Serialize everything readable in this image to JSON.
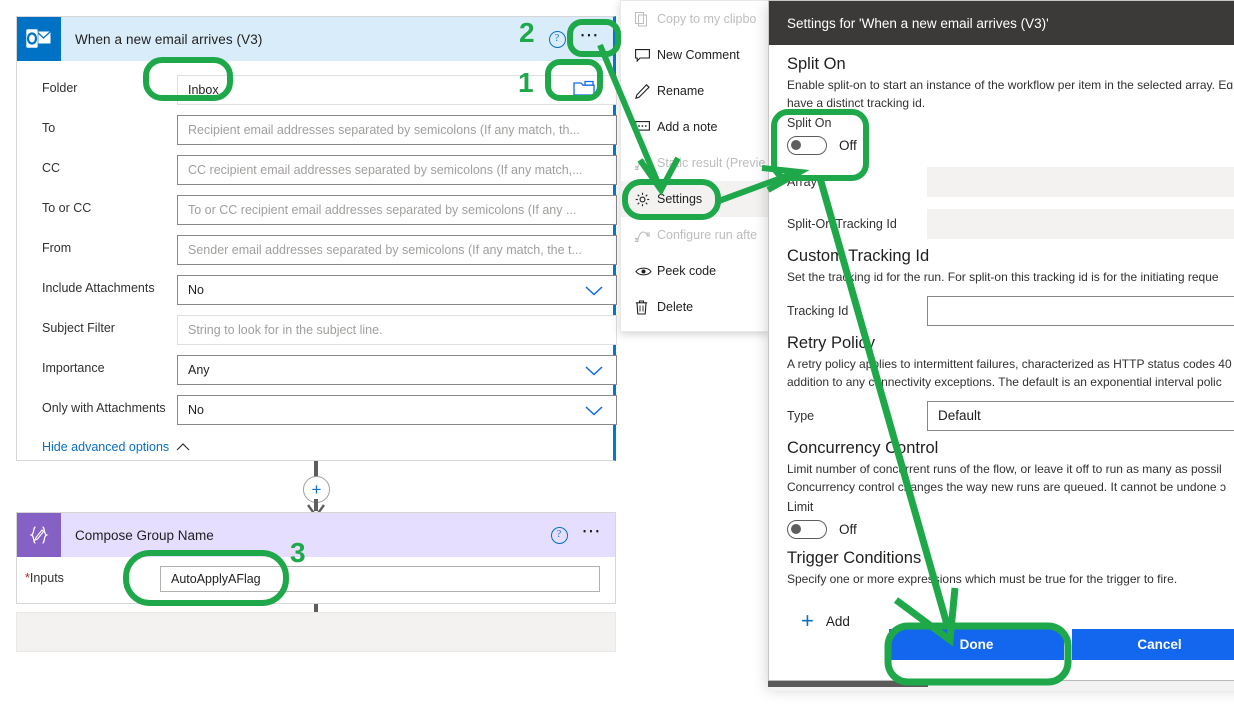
{
  "trigger_card": {
    "icon": "outlook-icon",
    "title": "When a new email arrives (V3)",
    "help_icon": "help-icon",
    "overflow_icon": "ellipsis-icon",
    "fields": [
      {
        "label": "Folder",
        "value": "Inbox",
        "placeholder": "",
        "type": "picker"
      },
      {
        "label": "To",
        "value": "",
        "placeholder": "Recipient email addresses separated by semicolons (If any match, th...",
        "type": "text"
      },
      {
        "label": "CC",
        "value": "",
        "placeholder": "CC recipient email addresses separated by semicolons (If any match,...",
        "type": "text"
      },
      {
        "label": "To or CC",
        "value": "",
        "placeholder": "To or CC recipient email addresses separated by semicolons (If any ...",
        "type": "text"
      },
      {
        "label": "From",
        "value": "",
        "placeholder": "Sender email addresses separated by semicolons (If any match, the t...",
        "type": "text"
      },
      {
        "label": "Include Attachments",
        "value": "No",
        "placeholder": "",
        "type": "select"
      },
      {
        "label": "Subject Filter",
        "value": "",
        "placeholder": "String to look for in the subject line.",
        "type": "text"
      },
      {
        "label": "Importance",
        "value": "Any",
        "placeholder": "",
        "type": "select"
      },
      {
        "label": "Only with Attachments",
        "value": "No",
        "placeholder": "",
        "type": "select"
      }
    ],
    "hide_advanced_label": "Hide advanced options"
  },
  "compose_card": {
    "icon": "compose-icon",
    "title": "Compose Group Name",
    "help_icon": "help-icon",
    "overflow_icon": "ellipsis-icon",
    "inputs_label": "Inputs",
    "required_marker": "*",
    "inputs_value": "AutoApplyAFlag"
  },
  "context_menu": {
    "items": [
      {
        "label": "Copy to my clipbo",
        "icon": "copy-icon",
        "disabled": true,
        "highlighted": false
      },
      {
        "label": "New Comment",
        "icon": "comment-icon",
        "disabled": false,
        "highlighted": false
      },
      {
        "label": "Rename",
        "icon": "pencil-icon",
        "disabled": false,
        "highlighted": false
      },
      {
        "label": "Add a note",
        "icon": "note-icon",
        "disabled": false,
        "highlighted": false
      },
      {
        "label": "Static result (Previe",
        "icon": "static-icon",
        "disabled": true,
        "highlighted": false
      },
      {
        "label": "Settings",
        "icon": "gear-icon",
        "disabled": false,
        "highlighted": true
      },
      {
        "label": "Configure run afte",
        "icon": "runafter-icon",
        "disabled": true,
        "highlighted": false
      },
      {
        "label": "Peek code",
        "icon": "eye-icon",
        "disabled": false,
        "highlighted": false
      },
      {
        "label": "Delete",
        "icon": "trash-icon",
        "disabled": false,
        "highlighted": false
      }
    ]
  },
  "settings_dialog": {
    "title": "Settings for 'When a new email arrives (V3)'",
    "sections": {
      "split_on": {
        "title": "Split On",
        "description_line1": "Enable split-on to start an instance of the workflow per item in the selected array. Eɑ",
        "description_line2": "have a distinct tracking id.",
        "toggle_label": "Split On",
        "toggle_state": "Off",
        "array_label": "Array",
        "array_value": "",
        "split_tracking_label": "Split-On Tracking Id",
        "split_tracking_value": ""
      },
      "custom_tracking": {
        "title": "Custom Tracking Id",
        "description": "Set the tracking id for the run. For split-on this tracking id is for the initiating reque",
        "tracking_label": "Tracking Id",
        "tracking_value": ""
      },
      "retry_policy": {
        "title": "Retry Policy",
        "description_line1": "A retry policy applies to intermittent failures, characterized as HTTP status codes 40",
        "description_line2": "addition to any connectivity exceptions. The default is an exponential interval polic",
        "type_label": "Type",
        "type_value": "Default"
      },
      "concurrency": {
        "title": "Concurrency Control",
        "description_line1": "Limit number of concurrent runs of the flow, or leave it off to run as many as possil",
        "description_line2": "Concurrency control changes the way new runs are queued. It cannot be undone ɔ",
        "limit_label": "Limit",
        "toggle_state": "Off"
      },
      "trigger_conditions": {
        "title": "Trigger Conditions",
        "description": "Specify one or more expressions which must be true for the trigger to fire.",
        "add_label": "Add",
        "add_icon": "plus-icon"
      }
    },
    "footer": {
      "done_label": "Done",
      "cancel_label": "Cancel"
    }
  },
  "annotations": {
    "markers": [
      {
        "id": "1",
        "text": "1"
      },
      {
        "id": "2",
        "text": "2"
      },
      {
        "id": "3",
        "text": "3"
      }
    ],
    "color": "#1ea84a"
  },
  "colors": {
    "accent_blue": "#0078d4",
    "annotation_green": "#1ea84a",
    "outlook_blue": "#0072c6",
    "compose_purple": "#8661c5",
    "dialog_header": "#3b3a39",
    "button_blue": "#1367ef"
  }
}
